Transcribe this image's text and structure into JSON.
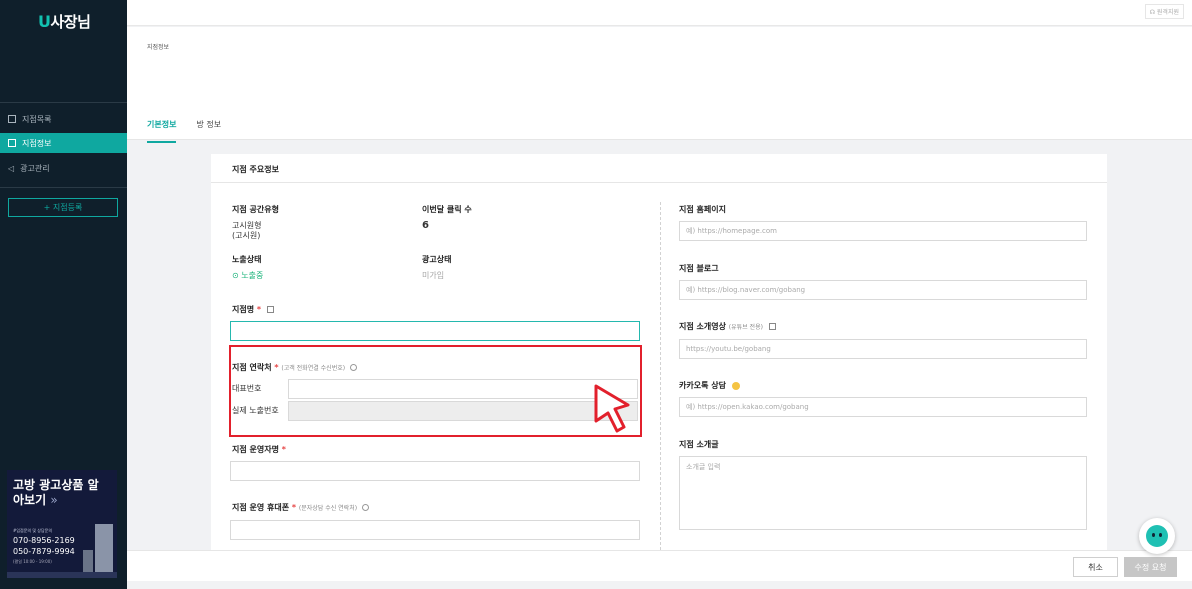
{
  "sidebar": {
    "logo_u": "U",
    "logo_text": "사장님",
    "items": [
      {
        "label": "지점목록"
      },
      {
        "label": "지점정보"
      },
      {
        "label": "광고관리"
      }
    ],
    "add_button": "+ 지점등록",
    "promo": {
      "title": "고방 광고상품 알아보기",
      "arrow": "»",
      "subtitle": "#입점문의 및 상담문의",
      "phone1": "070-8956-2169",
      "phone2": "050-7879-9994",
      "hours": "(평일 10:00 - 19:00)"
    }
  },
  "topbar": {
    "remote_support": "원격지원"
  },
  "header": {
    "breadcrumb": "지점정보",
    "tabs": [
      {
        "label": "기본정보",
        "active": true
      },
      {
        "label": "방 정보",
        "active": false
      }
    ]
  },
  "card": {
    "title": "지점 주요정보",
    "space_type_label": "지점 공간유형",
    "space_type_value1": "고시원형",
    "space_type_value2": "(고시원)",
    "clicks_label": "이번달 클릭 수",
    "clicks_value": "6",
    "exposure_label": "노출상태",
    "exposure_value": "⊙ 노출중",
    "ad_label": "광고상태",
    "ad_value": "미가입",
    "branch_name_label": "지점명",
    "req": "*",
    "contact_label": "지점 연락처",
    "contact_hint": "(고객 전화연결 수신번호)",
    "main_number_label": "대표번호",
    "real_number_label": "실제 노출번호",
    "operator_label": "지점 운영자명",
    "mobile_label": "지점 운영 휴대폰",
    "mobile_hint": "(문자상담 수신 연락처)",
    "homepage_label": "지점 홈페이지",
    "homepage_placeholder": "예) https://homepage.com",
    "blog_label": "지점 블로그",
    "blog_placeholder": "예) https://blog.naver.com/gobang",
    "video_label": "지점 소개영상",
    "video_hint": "(유튜브 전용)",
    "video_placeholder": "https://youtu.be/gobang",
    "kakao_label": "카카오톡 상담",
    "kakao_placeholder": "예) https://open.kakao.com/gobang",
    "intro_label": "지점 소개글",
    "intro_placeholder": "소개글 입력"
  },
  "footer": {
    "cancel": "취소",
    "submit": "수정 요청"
  },
  "colors": {
    "accent": "#0fa8a0",
    "sidebar_bg": "#0f1f2b",
    "highlight": "#e2202c"
  }
}
